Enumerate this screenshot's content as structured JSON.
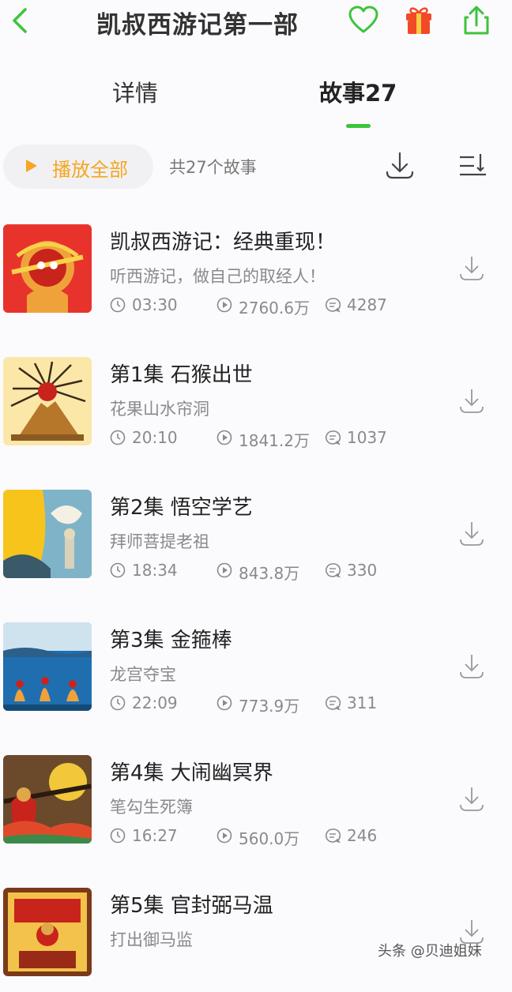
{
  "header": {
    "title": "凯叔西游记第一部",
    "back_icon": "chevron-left-icon",
    "favorite_icon": "heart-icon",
    "gift_icon": "gift-icon",
    "share_icon": "share-icon",
    "accent_color": "#3cc43c",
    "gift_color": "#f04a27"
  },
  "tabs": [
    {
      "label": "详情",
      "active": false
    },
    {
      "label": "故事27",
      "active": true
    }
  ],
  "toolbar": {
    "play_all_label": "播放全部",
    "story_count": "共27个故事",
    "download_all_icon": "download-icon",
    "sort_icon": "sort-icon",
    "play_color": "#f5a623"
  },
  "stories": [
    {
      "title": "凯叔西游记：经典重现！",
      "subtitle": "听西游记，做自己的取经人！",
      "duration": "03:30",
      "plays": "2760.6万",
      "comments": "4287"
    },
    {
      "title": "第1集 石猴出世",
      "subtitle": "花果山水帘洞",
      "duration": "20:10",
      "plays": "1841.2万",
      "comments": "1037"
    },
    {
      "title": "第2集 悟空学艺",
      "subtitle": "拜师菩提老祖",
      "duration": "18:34",
      "plays": "843.8万",
      "comments": "330"
    },
    {
      "title": "第3集 金箍棒",
      "subtitle": "龙宫夺宝",
      "duration": "22:09",
      "plays": "773.9万",
      "comments": "311"
    },
    {
      "title": "第4集 大闹幽冥界",
      "subtitle": "笔勾生死簿",
      "duration": "16:27",
      "plays": "560.0万",
      "comments": "246"
    },
    {
      "title": "第5集 官封弼马温",
      "subtitle": "打出御马监",
      "duration": "",
      "plays": "",
      "comments": ""
    }
  ],
  "watermark": "头条 @贝迪姐妹"
}
